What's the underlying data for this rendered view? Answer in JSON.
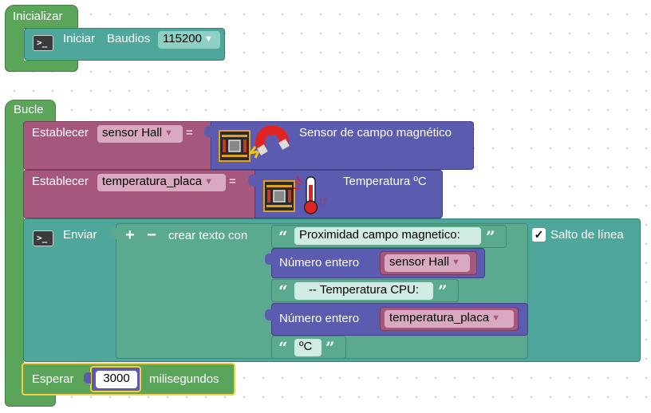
{
  "setup": {
    "hat_label": "Inicializar",
    "serial_begin": {
      "label": "Iniciar",
      "baud_label": "Baudios",
      "baud_value": "115200"
    }
  },
  "loop": {
    "hat_label": "Bucle",
    "set_hall": {
      "set_label": "Establecer",
      "variable": "sensor Hall",
      "equals": "=",
      "sensor_label": "Sensor de campo magnético"
    },
    "set_temp": {
      "set_label": "Establecer",
      "variable": "temperatura_placa",
      "equals": "=",
      "sensor_label": "Temperatura ºC"
    },
    "send": {
      "label": "Enviar",
      "plus": "+",
      "minus": "−",
      "create_text": "crear texto con",
      "items": {
        "text1": "Proximidad campo magnetico:",
        "num1_label": "Número entero",
        "num1_var": "sensor Hall",
        "text2": "-- Temperatura CPU:",
        "num2_label": "Número entero",
        "num2_var": "temperatura_placa",
        "text3": "ºC"
      },
      "newline_checkbox": {
        "checked": true,
        "label": "Salto de línea"
      }
    },
    "wait": {
      "label": "Esperar",
      "value": "3000",
      "unit": "milisegundos"
    }
  },
  "icons": {
    "terminal": "terminal-icon",
    "hall": "magnet-icon",
    "temperature": "thermometer-icon",
    "dropdown": "chevron-down-icon"
  },
  "colors": {
    "event_block": "#5ba55b",
    "io_block": "#4fa79b",
    "variable_block": "#a5577d",
    "sensor_block": "#5b5cb0",
    "text_block": "#5ba98f",
    "wait_highlight": "#f2cf3c"
  }
}
